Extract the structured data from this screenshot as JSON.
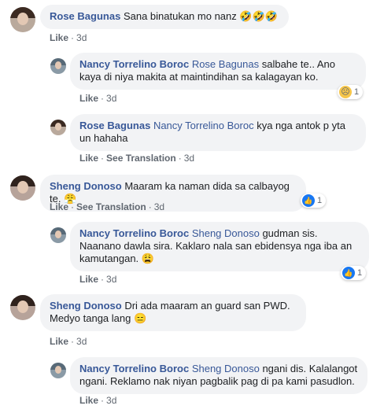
{
  "comments": [
    {
      "author": "Rose Bagunas",
      "mention": "",
      "text": "Sana binatukan mo nanz",
      "emoji": "🤣🤣🤣",
      "actions": {
        "like": "Like",
        "time": "3d"
      }
    },
    {
      "author": "Nancy Torrelino Boroc",
      "mention": "Rose Bagunas",
      "text": "salbahe te.. Ano kaya di niya makita at maintindihan sa kalagayan ko.",
      "actions": {
        "like": "Like",
        "time": "3d"
      },
      "reaction": {
        "icon": "sad-icon",
        "count": "1"
      }
    },
    {
      "author": "Rose Bagunas",
      "mention": "Nancy Torrelino Boroc",
      "text": "kya nga antok p yta un hahaha",
      "actions": {
        "like": "Like",
        "translate": "See Translation",
        "time": "3d"
      }
    },
    {
      "author": "Sheng Donoso",
      "mention": "",
      "text": "Maaram ka naman dida sa calbayog te.",
      "emoji": "😤",
      "actions": {
        "like": "Like",
        "translate": "See Translation",
        "time": "3d"
      },
      "reaction": {
        "icon": "like-icon",
        "count": "1"
      }
    },
    {
      "author": "Nancy Torrelino Boroc",
      "mention": "Sheng Donoso",
      "text": "gudman sis. Naanano dawla sira. Kaklaro nala san ebidensya nga iba an kamutangan.",
      "emoji": "😩",
      "actions": {
        "like": "Like",
        "time": "3d"
      },
      "reaction": {
        "icon": "like-icon",
        "count": "1"
      }
    },
    {
      "author": "Sheng Donoso",
      "mention": "",
      "text": "Dri ada maaram an guard san PWD. Medyo tanga lang",
      "emoji": "😑",
      "actions": {
        "like": "Like",
        "time": "3d"
      }
    },
    {
      "author": "Nancy Torrelino Boroc",
      "mention": "Sheng Donoso",
      "text": "ngani dis. Kalalangot ngani. Reklamo nak niyan pagbalik pag di pa kami pasudlon.",
      "actions": {
        "like": "Like",
        "time": "3d"
      }
    }
  ],
  "colors": {
    "name": "#385898",
    "bubble": "#f2f3f5",
    "meta": "#606770",
    "like": "#1877f2"
  }
}
